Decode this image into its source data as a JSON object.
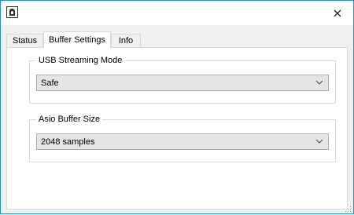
{
  "window": {
    "close_label": "×",
    "accent_color": "#1e8cdf"
  },
  "tabs": [
    {
      "label": "Status"
    },
    {
      "label": "Buffer Settings",
      "active": true
    },
    {
      "label": "Info"
    }
  ],
  "groups": {
    "usb_mode": {
      "label": "USB Streaming Mode",
      "selected": "Safe"
    },
    "asio_buffer": {
      "label": "Asio Buffer Size",
      "selected": "2048 samples"
    }
  },
  "icons": {
    "app": "app-logo-icon",
    "close": "close-icon",
    "dropdown": "chevron-down-icon",
    "resize": "resize-grip-icon"
  }
}
